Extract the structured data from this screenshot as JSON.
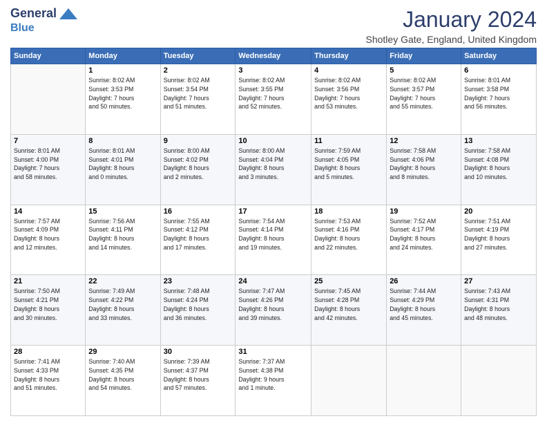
{
  "header": {
    "logo": {
      "line1": "General",
      "line2": "Blue"
    },
    "month": "January 2024",
    "location": "Shotley Gate, England, United Kingdom"
  },
  "days_of_week": [
    "Sunday",
    "Monday",
    "Tuesday",
    "Wednesday",
    "Thursday",
    "Friday",
    "Saturday"
  ],
  "weeks": [
    [
      {
        "day": "",
        "info": ""
      },
      {
        "day": "1",
        "info": "Sunrise: 8:02 AM\nSunset: 3:53 PM\nDaylight: 7 hours\nand 50 minutes."
      },
      {
        "day": "2",
        "info": "Sunrise: 8:02 AM\nSunset: 3:54 PM\nDaylight: 7 hours\nand 51 minutes."
      },
      {
        "day": "3",
        "info": "Sunrise: 8:02 AM\nSunset: 3:55 PM\nDaylight: 7 hours\nand 52 minutes."
      },
      {
        "day": "4",
        "info": "Sunrise: 8:02 AM\nSunset: 3:56 PM\nDaylight: 7 hours\nand 53 minutes."
      },
      {
        "day": "5",
        "info": "Sunrise: 8:02 AM\nSunset: 3:57 PM\nDaylight: 7 hours\nand 55 minutes."
      },
      {
        "day": "6",
        "info": "Sunrise: 8:01 AM\nSunset: 3:58 PM\nDaylight: 7 hours\nand 56 minutes."
      }
    ],
    [
      {
        "day": "7",
        "info": "Sunrise: 8:01 AM\nSunset: 4:00 PM\nDaylight: 7 hours\nand 58 minutes."
      },
      {
        "day": "8",
        "info": "Sunrise: 8:01 AM\nSunset: 4:01 PM\nDaylight: 8 hours\nand 0 minutes."
      },
      {
        "day": "9",
        "info": "Sunrise: 8:00 AM\nSunset: 4:02 PM\nDaylight: 8 hours\nand 2 minutes."
      },
      {
        "day": "10",
        "info": "Sunrise: 8:00 AM\nSunset: 4:04 PM\nDaylight: 8 hours\nand 3 minutes."
      },
      {
        "day": "11",
        "info": "Sunrise: 7:59 AM\nSunset: 4:05 PM\nDaylight: 8 hours\nand 5 minutes."
      },
      {
        "day": "12",
        "info": "Sunrise: 7:58 AM\nSunset: 4:06 PM\nDaylight: 8 hours\nand 8 minutes."
      },
      {
        "day": "13",
        "info": "Sunrise: 7:58 AM\nSunset: 4:08 PM\nDaylight: 8 hours\nand 10 minutes."
      }
    ],
    [
      {
        "day": "14",
        "info": "Sunrise: 7:57 AM\nSunset: 4:09 PM\nDaylight: 8 hours\nand 12 minutes."
      },
      {
        "day": "15",
        "info": "Sunrise: 7:56 AM\nSunset: 4:11 PM\nDaylight: 8 hours\nand 14 minutes."
      },
      {
        "day": "16",
        "info": "Sunrise: 7:55 AM\nSunset: 4:12 PM\nDaylight: 8 hours\nand 17 minutes."
      },
      {
        "day": "17",
        "info": "Sunrise: 7:54 AM\nSunset: 4:14 PM\nDaylight: 8 hours\nand 19 minutes."
      },
      {
        "day": "18",
        "info": "Sunrise: 7:53 AM\nSunset: 4:16 PM\nDaylight: 8 hours\nand 22 minutes."
      },
      {
        "day": "19",
        "info": "Sunrise: 7:52 AM\nSunset: 4:17 PM\nDaylight: 8 hours\nand 24 minutes."
      },
      {
        "day": "20",
        "info": "Sunrise: 7:51 AM\nSunset: 4:19 PM\nDaylight: 8 hours\nand 27 minutes."
      }
    ],
    [
      {
        "day": "21",
        "info": "Sunrise: 7:50 AM\nSunset: 4:21 PM\nDaylight: 8 hours\nand 30 minutes."
      },
      {
        "day": "22",
        "info": "Sunrise: 7:49 AM\nSunset: 4:22 PM\nDaylight: 8 hours\nand 33 minutes."
      },
      {
        "day": "23",
        "info": "Sunrise: 7:48 AM\nSunset: 4:24 PM\nDaylight: 8 hours\nand 36 minutes."
      },
      {
        "day": "24",
        "info": "Sunrise: 7:47 AM\nSunset: 4:26 PM\nDaylight: 8 hours\nand 39 minutes."
      },
      {
        "day": "25",
        "info": "Sunrise: 7:45 AM\nSunset: 4:28 PM\nDaylight: 8 hours\nand 42 minutes."
      },
      {
        "day": "26",
        "info": "Sunrise: 7:44 AM\nSunset: 4:29 PM\nDaylight: 8 hours\nand 45 minutes."
      },
      {
        "day": "27",
        "info": "Sunrise: 7:43 AM\nSunset: 4:31 PM\nDaylight: 8 hours\nand 48 minutes."
      }
    ],
    [
      {
        "day": "28",
        "info": "Sunrise: 7:41 AM\nSunset: 4:33 PM\nDaylight: 8 hours\nand 51 minutes."
      },
      {
        "day": "29",
        "info": "Sunrise: 7:40 AM\nSunset: 4:35 PM\nDaylight: 8 hours\nand 54 minutes."
      },
      {
        "day": "30",
        "info": "Sunrise: 7:39 AM\nSunset: 4:37 PM\nDaylight: 8 hours\nand 57 minutes."
      },
      {
        "day": "31",
        "info": "Sunrise: 7:37 AM\nSunset: 4:38 PM\nDaylight: 9 hours\nand 1 minute."
      },
      {
        "day": "",
        "info": ""
      },
      {
        "day": "",
        "info": ""
      },
      {
        "day": "",
        "info": ""
      }
    ]
  ]
}
